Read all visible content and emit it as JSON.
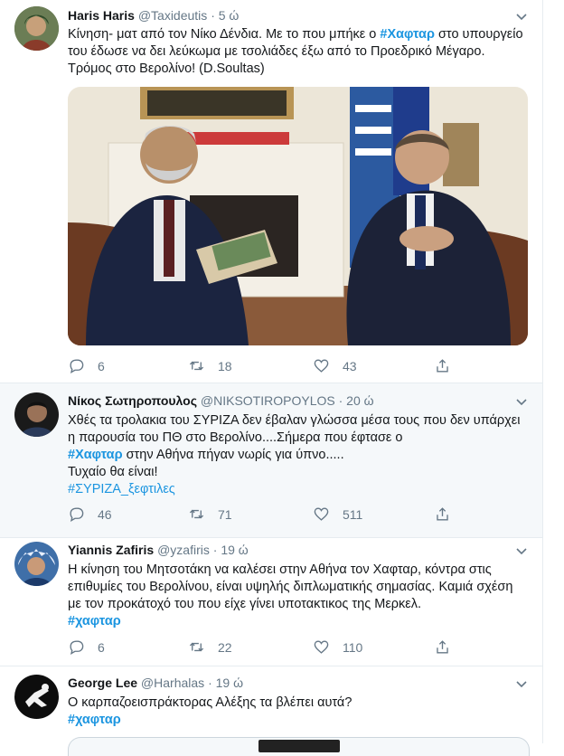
{
  "tweets": [
    {
      "name": "Haris Haris",
      "handle": "@Taxideutis",
      "sep": "·",
      "time": "5 ώ",
      "text_parts": [
        "Κίνηση- ματ από τον Νίκο Δένδια. Με το που μπήκε ο ",
        "#Χαφταρ",
        "  στο υπουργείο του έδωσε να δει λεύκωμα με τσολιάδες έξω από το Προεδρικό Μέγαρο. Τρόμος στο Βερολίνο!  (D.Soultas)"
      ],
      "replies": "6",
      "retweets": "18",
      "likes": "43"
    },
    {
      "name": "Νίκος Σωτηροπουλος",
      "handle": "@NIKSOTIROPOYLOS",
      "sep": "·",
      "time": "20 ώ",
      "text_parts": [
        "Χθές τα τρολακια του ΣΥΡΙΖΑ δεν έβαλαν γλώσσα μέσα τους που δεν υπάρχει η παρουσία του ΠΘ στο Βερολίνο....Σήμερα που έφτασε ο ",
        "#Χαφταρ",
        " στην Αθήνα πήγαν νωρίς για ύπνο.....",
        "Τυχαίο θα είναι!",
        "#ΣΥΡΙΖΑ_ξεφτιλες"
      ],
      "replies": "46",
      "retweets": "71",
      "likes": "511"
    },
    {
      "name": "Yiannis Zafiris",
      "handle": "@yzafiris",
      "sep": "·",
      "time": "19 ώ",
      "text_parts": [
        "Η κίνηση του Μητσοτάκη να καλέσει στην Αθήνα τον Χαφταρ, κόντρα στις επιθυμίες του Βερολίνου, είναι υψηλής διπλωματικής σημασίας. Καμιά σχέση με τον προκάτοχό του που είχε γίνει υποτακτικος της Μερκελ.",
        "#χαφταρ"
      ],
      "replies": "6",
      "retweets": "22",
      "likes": "110"
    },
    {
      "name": "George Lee",
      "handle": "@Harhalas",
      "sep": "·",
      "time": "19 ώ",
      "text_parts": [
        "Ο καρπαζοεισπράκτορας Αλέξης τα βλέπει αυτά?",
        "#χαφταρ"
      ]
    }
  ],
  "colors": {
    "link": "#1b95e0",
    "muted": "#657786",
    "border": "#e6ecf0"
  },
  "icons": [
    "chevron-down-icon",
    "reply-icon",
    "retweet-icon",
    "like-icon",
    "share-icon"
  ]
}
